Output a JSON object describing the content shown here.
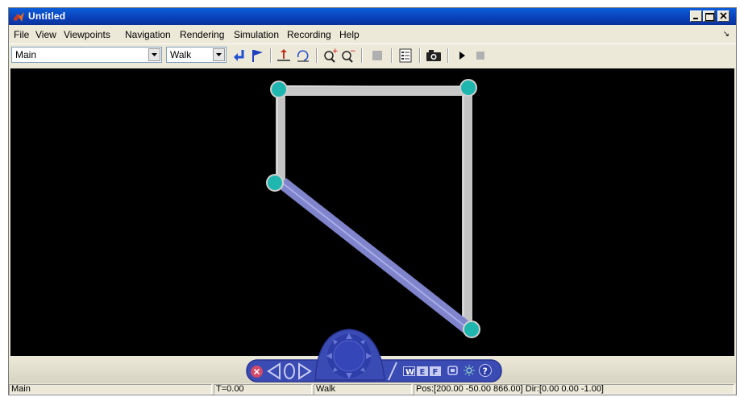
{
  "window": {
    "title": "Untitled"
  },
  "menu": [
    "File",
    "View",
    "Viewpoints",
    "Navigation",
    "Rendering",
    "Simulation",
    "Recording",
    "Help"
  ],
  "toolbar": {
    "viewpoint_select": "Main",
    "navigation_select": "Walk",
    "icons": [
      "return-to-viewpoint-icon",
      "create-viewpoint-icon",
      "straighten-up-icon",
      "undo-move-icon",
      "zoom-in-icon",
      "zoom-out-icon",
      "stop-icon",
      "properties-icon",
      "snapshot-icon",
      "play-icon",
      "stop-recording-icon"
    ]
  },
  "navigation_panel": {
    "mode_buttons": [
      "W",
      "E",
      "F"
    ]
  },
  "statusbar": {
    "viewpoint": "Main",
    "time": "T=0.00",
    "mode": "Walk",
    "position": "Pos:[200.00 -50.00 866.00] Dir:[0.00 0.00 -1.00]"
  },
  "colors": {
    "titlebar": "#0a46c8",
    "scene_background": "#000000",
    "node_fill": "#1fb6b0",
    "link_gray": "#c8c8c8",
    "link_blue": "#7f84cc",
    "nav_panel": "#3a4bb4"
  }
}
